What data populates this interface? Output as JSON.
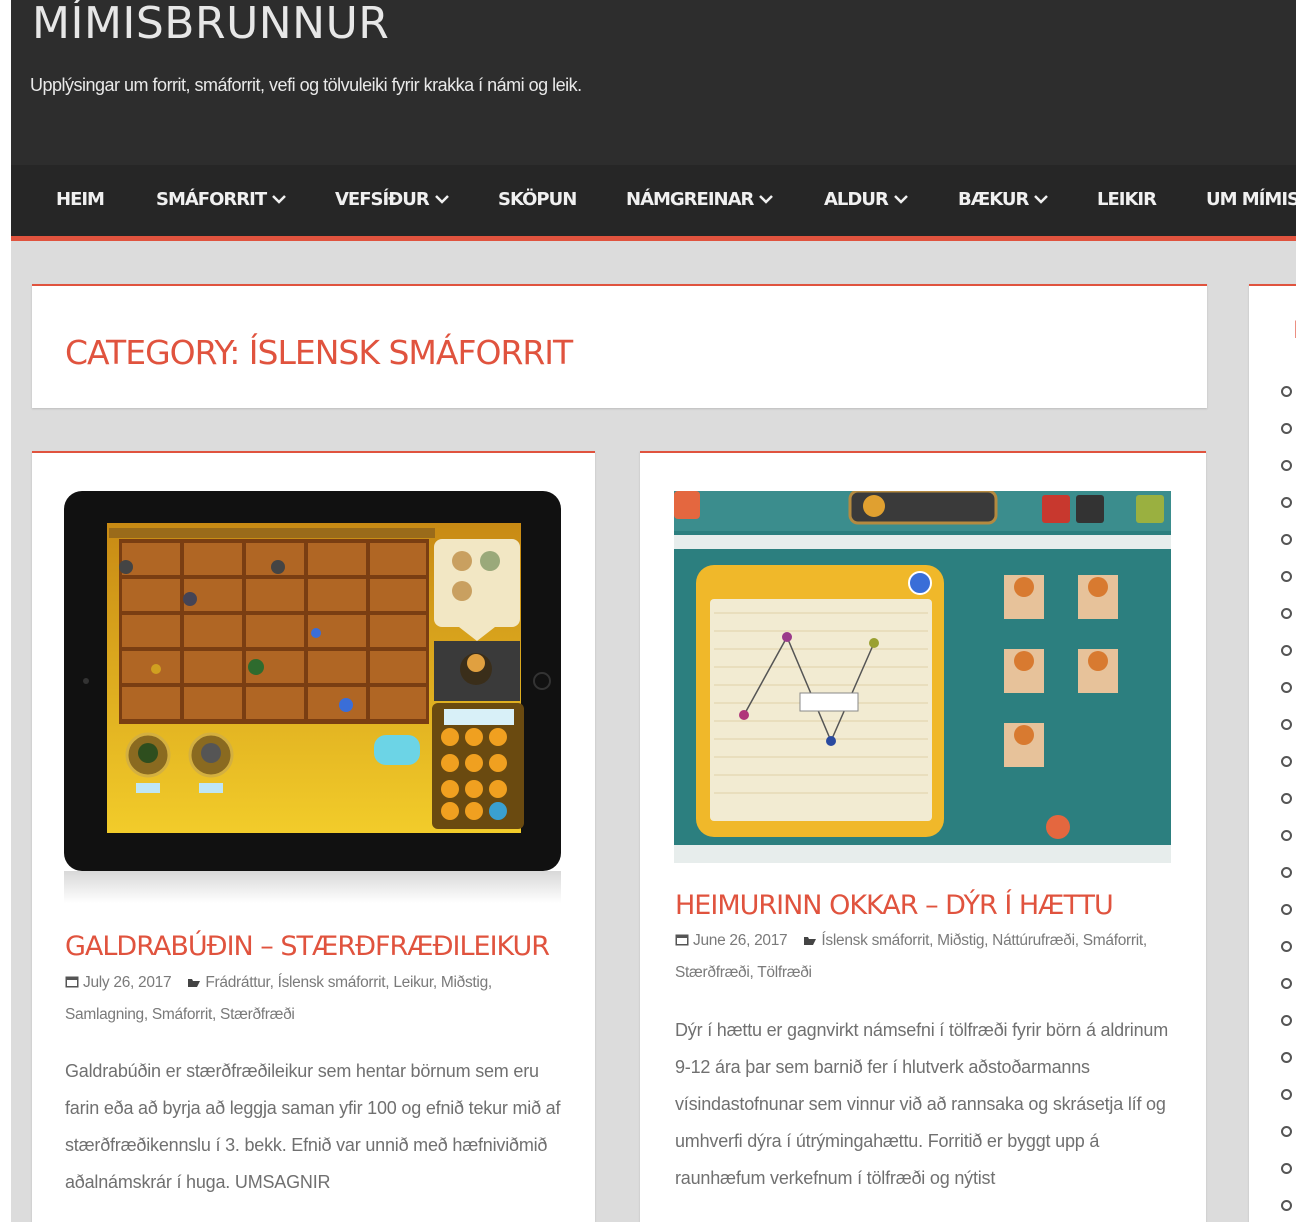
{
  "site": {
    "title": "MÍMISBRUNNUR",
    "tagline": "Upplýsingar um forrit, smáforrit, vefi og tölvuleiki fyrir krakka í námi og leik."
  },
  "nav": {
    "items": [
      {
        "label": "HEIM",
        "dropdown": false
      },
      {
        "label": "SMÁFORRIT",
        "dropdown": true
      },
      {
        "label": "VEFSÍÐUR",
        "dropdown": true
      },
      {
        "label": "SKÖPUN",
        "dropdown": false
      },
      {
        "label": "NÁMGREINAR",
        "dropdown": true
      },
      {
        "label": "ALDUR",
        "dropdown": true
      },
      {
        "label": "BÆKUR",
        "dropdown": true
      },
      {
        "label": "LEIKIR",
        "dropdown": false
      },
      {
        "label": "UM MÍMIS",
        "dropdown": false
      }
    ]
  },
  "category": {
    "title": "CATEGORY: ÍSLENSK SMÁFORRIT"
  },
  "posts": [
    {
      "title": "GALDRABÚÐIN – STÆRÐFRÆÐILEIKUR",
      "date": "July 26, 2017",
      "categories": "Frádráttur, Íslensk smáforrit, Leikur, Miðstig, Samlagning, Smáforrit, Stærðfræði",
      "excerpt": "Galdrabúðin er stærðfræðileikur sem hentar börnum sem eru farin eða að byrja að leggja saman yfir 100 og efnið tekur mið af stærðfræðikennslu í 3. bekk. Efnið var unnið með hæfniviðmið aðalnámskrár í huga. UMSAGNIR"
    },
    {
      "title": "HEIMURINN OKKAR – DÝR Í HÆTTU",
      "date": "June 26, 2017",
      "categories": "Íslensk smáforrit, Miðstig, Náttúrufræði, Smáforrit, Stærðfræði, Tölfræði",
      "excerpt": "Dýr í hættu er gagnvirkt námsefni í tölfræði fyrir börn á aldrinum 9-12 ára þar sem barnið fer í hlutverk aðstoðarmanns vísindastofnunar sem vinnur við að rannsaka og skrásetja líf og umhverfi dýra í útrýmingahættu. Forritið er byggt upp á raunhæfum verkefnum í tölfræði og nýtist"
    }
  ],
  "sidebar": {
    "title": "E"
  },
  "colors": {
    "accent": "#e0533e",
    "header_bg": "#2d2d2d",
    "nav_bg": "#262626",
    "page_bg": "#dcdcdc"
  },
  "icons": {
    "date": "calendar-icon",
    "categories": "folder-icon",
    "dropdown": "chevron-down-icon",
    "list": "circle-bullet-icon"
  }
}
